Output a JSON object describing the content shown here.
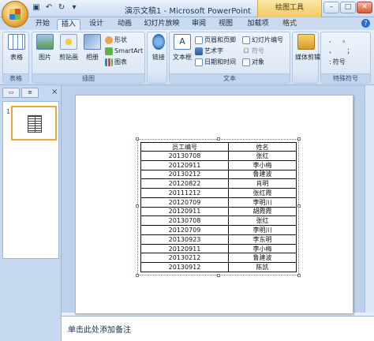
{
  "window": {
    "title": "演示文稿1 - Microsoft PowerPoint",
    "context_tab_title": "绘图工具"
  },
  "qat": {
    "save_icon": "save-icon",
    "undo_icon": "undo-icon",
    "redo_icon": "redo-icon",
    "customize_icon": "customize-qat-icon"
  },
  "tabs": [
    {
      "label": "开始"
    },
    {
      "label": "插入"
    },
    {
      "label": "设计"
    },
    {
      "label": "动画"
    },
    {
      "label": "幻灯片放映"
    },
    {
      "label": "审阅"
    },
    {
      "label": "视图"
    },
    {
      "label": "加载项"
    },
    {
      "label": "格式"
    }
  ],
  "active_tab": "插入",
  "ribbon": {
    "groups": {
      "tables": {
        "label": "表格",
        "table_btn": "表格"
      },
      "illustrations": {
        "label": "插图",
        "picture": "图片",
        "clipart": "剪贴画",
        "album": "相册",
        "shapes": "形状",
        "smartart": "SmartArt",
        "chart": "图表"
      },
      "links": {
        "link": "链接"
      },
      "text": {
        "label": "文本",
        "textbox": "文本框",
        "header_footer": "页眉和页脚",
        "wordart": "艺术字",
        "datetime": "日期和时间",
        "slide_number": "幻灯片编号",
        "symbol": "符号",
        "object": "对象"
      },
      "media": {
        "media_clip": "媒体剪辑"
      },
      "special_symbols": {
        "label": "特殊符号",
        "symbol": "符号"
      }
    }
  },
  "table": {
    "headers": [
      "员工编号",
      "姓名"
    ],
    "rows": [
      [
        "20130708",
        "张红"
      ],
      [
        "20120911",
        "李小梅"
      ],
      [
        "20130212",
        "鲁建波"
      ],
      [
        "20120822",
        "肖明"
      ],
      [
        "20111212",
        "张红霞"
      ],
      [
        "20120709",
        "李明川"
      ],
      [
        "20120911",
        "胡霞霞"
      ],
      [
        "20130708",
        "张红"
      ],
      [
        "20120709",
        "李明川"
      ],
      [
        "20130923",
        "李东明"
      ],
      [
        "20120911",
        "李小梅"
      ],
      [
        "20130212",
        "鲁建波"
      ],
      [
        "20130912",
        "陈凯"
      ]
    ]
  },
  "notes": {
    "placeholder": "单击此处添加备注"
  },
  "left_panel": {
    "slide_number": "1",
    "close_label": "×"
  }
}
